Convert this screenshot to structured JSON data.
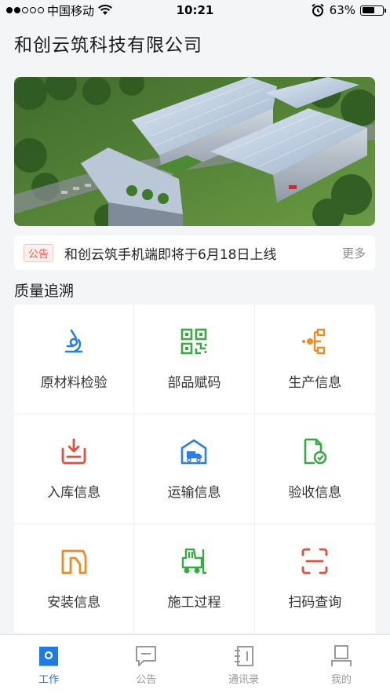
{
  "status_bar": {
    "carrier": "中国移动",
    "time": "10:21",
    "battery": "63%",
    "battery_level": 0.63
  },
  "company_name": "和创云筑科技有限公司",
  "notice": {
    "tag": "公告",
    "text": "和创云筑手机端即将于6月18日上线",
    "more": "更多"
  },
  "section_title": "质量追溯",
  "grid": [
    {
      "label": "原材料检验",
      "icon": "microscope-icon",
      "color": "#2b7de9"
    },
    {
      "label": "部品赋码",
      "icon": "qrcode-icon",
      "color": "#3aa843"
    },
    {
      "label": "生产信息",
      "icon": "production-flow-icon",
      "color": "#f08a24"
    },
    {
      "label": "入库信息",
      "icon": "inbox-download-icon",
      "color": "#e84c3d"
    },
    {
      "label": "运输信息",
      "icon": "warehouse-truck-icon",
      "color": "#2b7de9"
    },
    {
      "label": "验收信息",
      "icon": "document-check-icon",
      "color": "#3aa843"
    },
    {
      "label": "安装信息",
      "icon": "install-bracket-icon",
      "color": "#f08a24"
    },
    {
      "label": "施工过程",
      "icon": "forklift-icon",
      "color": "#3aa843"
    },
    {
      "label": "扫码查询",
      "icon": "scan-icon",
      "color": "#e84c3d"
    }
  ],
  "tabs": [
    {
      "label": "工作",
      "icon": "work-icon",
      "active": true
    },
    {
      "label": "公告",
      "icon": "message-icon",
      "active": false
    },
    {
      "label": "通讯录",
      "icon": "contacts-icon",
      "active": false
    },
    {
      "label": "我的",
      "icon": "profile-icon",
      "active": false
    }
  ],
  "colors": {
    "accent": "#1e7be0",
    "notice_tag": "#e85a4f",
    "background": "#f4f5f7"
  }
}
